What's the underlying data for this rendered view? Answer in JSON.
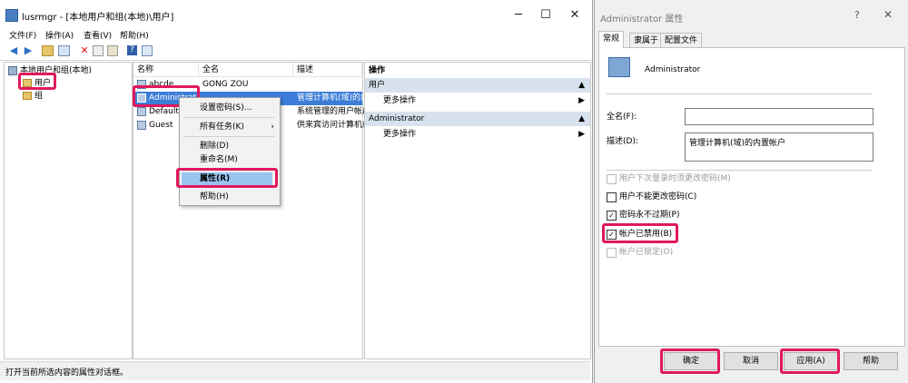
{
  "left_window": {
    "title": "lusrmgr - [本地用户和组(本地)\\用户]",
    "controls": {
      "minimize": "─",
      "maximize": "☐",
      "close": "✕"
    },
    "menu": [
      "文件(F)",
      "操作(A)",
      "查看(V)",
      "帮助(H)"
    ],
    "tree": {
      "root": "本地用户和组(本地)",
      "children": [
        "用户",
        "组"
      ]
    },
    "list": {
      "columns": [
        "名称",
        "全名",
        "描述"
      ],
      "rows": [
        {
          "name": "abcde",
          "fullname": "GONG ZOU",
          "desc": ""
        },
        {
          "name": "Administrat...",
          "fullname": "",
          "desc": "管理计算机(域)的内"
        },
        {
          "name": "DefaultA...",
          "fullname": "",
          "desc": "系统管理的用户帐户"
        },
        {
          "name": "Guest",
          "fullname": "",
          "desc": "供来宾访问计算机或"
        }
      ]
    },
    "actions": {
      "header": "操作",
      "sections": [
        {
          "title": "用户",
          "item": "更多操作"
        },
        {
          "title": "Administrator",
          "item": "更多操作"
        }
      ]
    },
    "context_menu": {
      "items": [
        "设置密码(S)...",
        "所有任务(K)",
        "删除(D)",
        "重命名(M)",
        "属性(R)",
        "帮助(H)"
      ]
    },
    "status": "打开当前所选内容的属性对话框。"
  },
  "dialog": {
    "title": "Administrator 属性",
    "controls": {
      "help": "?",
      "close": "✕"
    },
    "tabs": [
      "常规",
      "隶属于",
      "配置文件"
    ],
    "account_name": "Administrator",
    "fullname_label": "全名(F):",
    "fullname_value": "",
    "desc_label": "描述(D):",
    "desc_value": "管理计算机(域)的内置帐户",
    "checkboxes": [
      {
        "label": "用户下次登录时须更改密码(M)",
        "checked": false,
        "enabled": false
      },
      {
        "label": "用户不能更改密码(C)",
        "checked": false,
        "enabled": true
      },
      {
        "label": "密码永不过期(P)",
        "checked": true,
        "enabled": true
      },
      {
        "label": "帐户已禁用(B)",
        "checked": true,
        "enabled": true
      },
      {
        "label": "帐户已锁定(O)",
        "checked": false,
        "enabled": false
      }
    ],
    "buttons": {
      "ok": "确定",
      "cancel": "取消",
      "apply": "应用(A)",
      "help": "帮助"
    }
  },
  "highlight_color": "#e0195d",
  "selection_color": "#3b7dd8"
}
